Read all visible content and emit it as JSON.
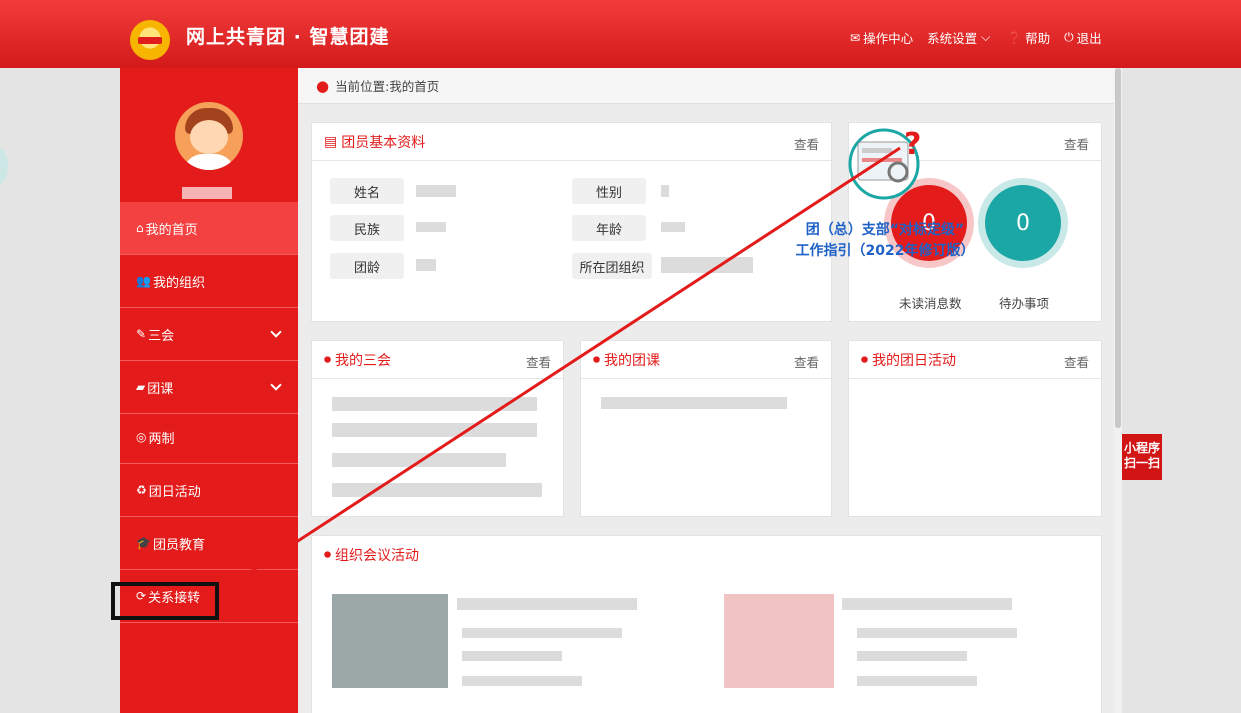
{
  "header": {
    "title": "网上共青团 · 智慧团建",
    "nav": [
      {
        "icon": "envelope-icon",
        "label": "操作中心"
      },
      {
        "icon": "none",
        "label": "系统设置"
      },
      {
        "icon": "question-circle-icon",
        "label": "帮助"
      },
      {
        "icon": "power-icon",
        "label": "退出"
      }
    ]
  },
  "sidebar": {
    "items": [
      {
        "icon": "home-icon",
        "label": "我的首页",
        "active": true
      },
      {
        "icon": "users-icon",
        "label": "我的组织"
      },
      {
        "icon": "edit-icon",
        "label": "三会",
        "expandable": true
      },
      {
        "icon": "folder-icon",
        "label": "团课",
        "expandable": true
      },
      {
        "icon": "target-icon",
        "label": "两制"
      },
      {
        "icon": "recycle-icon",
        "label": "团日活动"
      },
      {
        "icon": "graduation-cap-icon",
        "label": "团员教育"
      },
      {
        "icon": "refresh-icon",
        "label": "关系接转"
      }
    ]
  },
  "breadcrumb": "当前位置:我的首页",
  "profile_card": {
    "title": "团员基本资料",
    "more": "查看",
    "fields": [
      "姓名",
      "性别",
      "民族",
      "年龄",
      "团龄",
      "所在团组织"
    ]
  },
  "stats_card": {
    "more": "查看",
    "unread_value": "0",
    "unread_label": "未读消息数",
    "todo_value": "0",
    "todo_label": "待办事项"
  },
  "cards": {
    "meetings": {
      "title": "我的三会",
      "more": "查看"
    },
    "lessons": {
      "title": "我的团课",
      "more": "查看"
    },
    "activities": {
      "title": "我的团日活动",
      "more": "查看"
    },
    "org_meetings": {
      "title": "组织会议活动"
    }
  },
  "overlay": {
    "line1": "团（总）支部“对标定级”",
    "line2": "工作指引（2022年修订版）"
  },
  "miniapp": {
    "line1": "小程序",
    "line2": "扫一扫"
  },
  "colors": {
    "brand_red": "#e31b1b",
    "teal": "#1aa7a5",
    "overlay_blue": "#1f62c7"
  }
}
